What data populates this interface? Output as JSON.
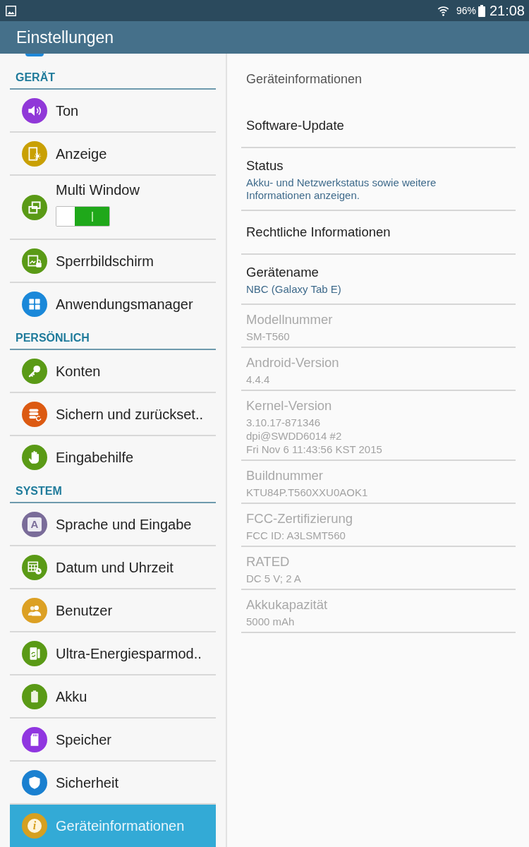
{
  "status_bar": {
    "battery": "96%",
    "time": "21:08"
  },
  "header": {
    "title": "Einstellungen"
  },
  "sidebar": {
    "sections": [
      {
        "title": "GERÄT",
        "items": [
          {
            "label": "Ton",
            "kind": "link",
            "color": "#9038d8",
            "selected": false
          },
          {
            "label": "Anzeige",
            "kind": "link",
            "color": "#c9a004",
            "selected": false
          },
          {
            "label": "Multi Window",
            "kind": "toggle",
            "on": true,
            "color": "#5a9a16",
            "selected": false
          },
          {
            "label": "Sperrbildschirm",
            "kind": "link",
            "color": "#5a9a16",
            "selected": false
          },
          {
            "label": "Anwendungsmanager",
            "kind": "link",
            "color": "#1a88d9",
            "selected": false
          }
        ]
      },
      {
        "title": "PERSÖNLICH",
        "items": [
          {
            "label": "Konten",
            "kind": "link",
            "color": "#5a9a16",
            "selected": false
          },
          {
            "label": "Sichern und zurückset..",
            "kind": "link",
            "color": "#dc5a12",
            "selected": false
          },
          {
            "label": "Eingabehilfe",
            "kind": "link",
            "color": "#5a9a16",
            "selected": false
          }
        ]
      },
      {
        "title": "SYSTEM",
        "items": [
          {
            "label": "Sprache und Eingabe",
            "kind": "link",
            "color": "#7a6c99",
            "icon_text": "A",
            "selected": false
          },
          {
            "label": "Datum und Uhrzeit",
            "kind": "link",
            "color": "#5a9a16",
            "selected": false
          },
          {
            "label": "Benutzer",
            "kind": "link",
            "color": "#dca024",
            "selected": false
          },
          {
            "label": "Ultra-Energiesparmod..",
            "kind": "link",
            "color": "#5a9a16",
            "selected": false
          },
          {
            "label": "Akku",
            "kind": "link",
            "color": "#5a9a16",
            "selected": false
          },
          {
            "label": "Speicher",
            "kind": "link",
            "color": "#9036e0",
            "selected": false
          },
          {
            "label": "Sicherheit",
            "kind": "link",
            "color": "#1a80d0",
            "selected": false
          },
          {
            "label": "Geräteinformationen",
            "kind": "link",
            "color": "#d6a020",
            "icon_text": "i",
            "selected": true
          }
        ]
      }
    ]
  },
  "detail": {
    "title": "Geräteinformationen",
    "items": [
      {
        "title": "Software-Update",
        "disabled": false
      },
      {
        "title": "Status",
        "summary": "Akku- und Netzwerkstatus sowie weitere Informationen anzeigen.",
        "disabled": false
      },
      {
        "title": "Rechtliche Informationen",
        "disabled": false
      },
      {
        "title": "Gerätename",
        "summary": "NBC (Galaxy Tab E)",
        "disabled": false
      },
      {
        "title": "Modellnummer",
        "summary": "SM-T560",
        "disabled": true
      },
      {
        "title": "Android-Version",
        "summary": "4.4.4",
        "disabled": true
      },
      {
        "title": "Kernel-Version",
        "summary": "3.10.17-871346\ndpi@SWDD6014 #2\nFri Nov 6 11:43:56 KST 2015",
        "disabled": true
      },
      {
        "title": "Buildnummer",
        "summary": "KTU84P.T560XXU0AOK1",
        "disabled": true
      },
      {
        "title": "FCC-Zertifizierung",
        "summary": "FCC ID: A3LSMT560",
        "disabled": true
      },
      {
        "title": "RATED",
        "summary": "DC 5 V; 2 A",
        "disabled": true
      },
      {
        "title": "Akkukapazität",
        "summary": "5000 mAh",
        "disabled": true
      }
    ]
  }
}
